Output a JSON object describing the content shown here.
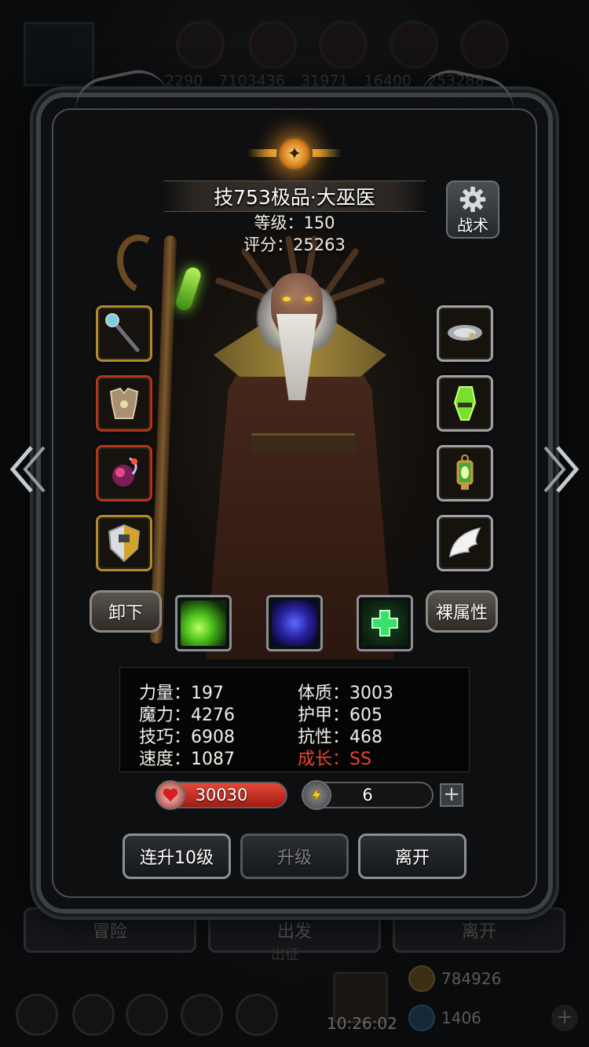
{
  "background": {
    "stats": [
      "2290",
      "7103436",
      "31971",
      "16400",
      "253288"
    ],
    "buttons": [
      "冒险",
      "出发",
      "离开"
    ],
    "subtext": "出征",
    "resources": {
      "gold": "784926",
      "gems": "1406"
    },
    "clock": "10:26:02"
  },
  "hero": {
    "name": "技753极品·大巫医",
    "level_line": "等级：150",
    "score_line": "评分：25263"
  },
  "tactics": {
    "label": "战术",
    "icon": "gear-icon"
  },
  "equipment": {
    "left": [
      {
        "name": "staff-icon",
        "rarity": "gold"
      },
      {
        "name": "armor-icon",
        "rarity": "red"
      },
      {
        "name": "orb-icon",
        "rarity": "red"
      },
      {
        "name": "shield-icon",
        "rarity": "gold"
      }
    ],
    "right": [
      {
        "name": "cloud-ring-icon",
        "rarity": "grey"
      },
      {
        "name": "green-crystal-icon",
        "rarity": "grey"
      },
      {
        "name": "lantern-icon",
        "rarity": "grey"
      },
      {
        "name": "wing-icon",
        "rarity": "grey"
      }
    ]
  },
  "controls": {
    "unequip": "卸下",
    "base_attributes": "裸属性"
  },
  "skills": [
    {
      "name": "green-slash-skill-icon",
      "color": "#5fdc2a"
    },
    {
      "name": "blue-spirit-skill-icon",
      "color": "#3a46d8"
    },
    {
      "name": "green-cross-skill-icon",
      "color": "#2ed65a"
    }
  ],
  "stats": {
    "strength": "力量：197",
    "constitution": "体质：3003",
    "magic": "魔力：4276",
    "armor": "护甲：605",
    "skill": "技巧：6908",
    "resistance": "抗性：468",
    "speed": "速度：1087",
    "growth": "成长：SS"
  },
  "bars": {
    "hp": "30030",
    "energy": "6",
    "hp_color": "#c8281c"
  },
  "actions": {
    "level10": "连升10级",
    "levelup": "升级",
    "leave": "离开"
  },
  "accent_colors": {
    "gold_frame": "#b18a2a",
    "red_frame": "#b5341e",
    "growth_text": "#e8442c"
  }
}
